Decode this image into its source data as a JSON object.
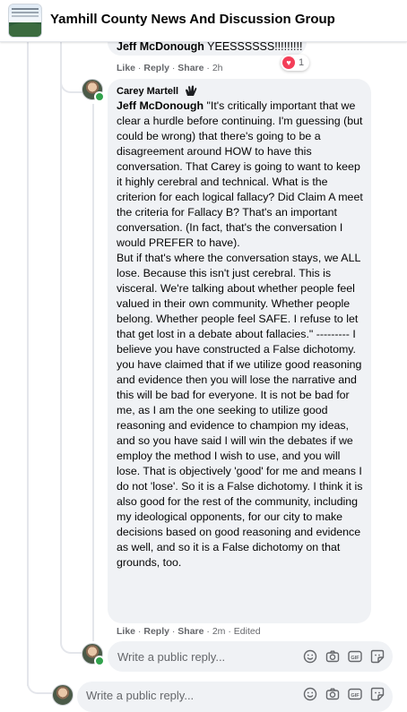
{
  "header": {
    "group_name": "Yamhill County News And Discussion Group"
  },
  "previous_comment": {
    "author": "Jeff McDonough",
    "text": "YEESSSSSS!!!!!!!!!",
    "actions": {
      "like": "Like",
      "reply": "Reply",
      "share": "Share",
      "time": "2h"
    },
    "reactions": {
      "icon": "heart-icon",
      "count": "1"
    }
  },
  "comment": {
    "author": "Carey Martell",
    "author_badge": "clapping-hands-icon",
    "tagged": "Jeff McDonough",
    "paragraph_1": "\"It's critically important that we clear a hurdle before continuing. I'm guessing (but could be wrong) that there's going to be a disagreement around HOW to have this conversation. That Carey is going to want to keep it highly cerebral and technical. What is the criterion for each logical fallacy? Did Claim A meet the criteria for Fallacy B? That's an important conversation. (In fact, that's the conversation I would PREFER to have).",
    "paragraph_2": "But if that's where the conversation stays, we ALL lose. Because this isn't just cerebral. This is visceral. We're talking about whether people feel valued in their own community. Whether people belong. Whether people feel SAFE. I refuse to let that get lost in a debate about fallacies.\" --------- I believe you have constructed a False dichotomy. you have claimed that if we utilize good reasoning and evidence then you will lose the narrative and this will be bad for everyone. It is not be bad for me, as I am the one seeking to utilize good reasoning and evidence to champion my ideas, and so you have said I will win the debates if we employ the method I wish to use, and you will lose. That is objectively 'good' for me and means I do not 'lose'. So it is a False dichotomy. I think it is also good for the rest of the community, including my ideological opponents, for our city to make decisions based on good reasoning and evidence as well, and so it is a False dichotomy on that grounds, too.",
    "actions": {
      "like": "Like",
      "reply": "Reply",
      "share": "Share",
      "time": "2m",
      "edited": "Edited"
    }
  },
  "reply_box": {
    "placeholder": "Write a public reply...",
    "icons": [
      "emoji-icon",
      "camera-icon",
      "gif-icon",
      "sticker-icon"
    ]
  },
  "bottom_reply_box": {
    "placeholder": "Write a public reply...",
    "icons": [
      "emoji-icon",
      "camera-icon",
      "gif-icon",
      "sticker-icon"
    ]
  },
  "colors": {
    "bubble": "#f0f2f5",
    "meta_text": "#65676b",
    "heart": "#f33e58",
    "online": "#31a24c"
  }
}
